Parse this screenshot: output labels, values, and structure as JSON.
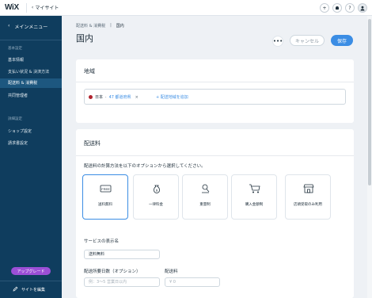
{
  "topbar": {
    "logo": "WiX",
    "mysite": "マイサイト",
    "icons": [
      "add-icon",
      "bell-icon",
      "help-icon",
      "avatar"
    ]
  },
  "sidebar": {
    "main_menu": "メインメニュー",
    "sections": [
      {
        "title": "基本設定",
        "items": [
          "基本情報",
          "支払い状況 & 決済方法",
          "配送料 & 消費税",
          "共同管理者"
        ]
      },
      {
        "title": "詳細設定",
        "items": [
          "ショップ設定",
          "請求書設定"
        ]
      }
    ],
    "active_item": "配送料 & 消費税",
    "upgrade_label": "アップグレード",
    "edit_site_label": "サイトを編集"
  },
  "header": {
    "breadcrumb": [
      "配送料 & 消費税",
      "国内"
    ],
    "title": "国内",
    "more_label": "•••",
    "cancel_label": "キャンセル",
    "save_label": "保存"
  },
  "region_card": {
    "title": "地域",
    "tag_country": "日本",
    "tag_sub": "47 都道府県",
    "tag_remove": "×",
    "add_label": "+ 配送地域を追加"
  },
  "shipping_card": {
    "title": "配送料",
    "description": "配送料の計算方法を以下のオプションから選択してください。",
    "options": [
      {
        "label": "送料無料",
        "icon": "free-icon",
        "selected": true
      },
      {
        "label": "一律料金",
        "icon": "money-bag-icon",
        "selected": false
      },
      {
        "label": "重量制",
        "icon": "weight-icon",
        "selected": false
      },
      {
        "label": "購入金額制",
        "icon": "cart-icon",
        "selected": false
      },
      {
        "label": "店頭受取のみ利用",
        "icon": "store-icon",
        "selected": false
      }
    ],
    "service_label": "サービスの表示名",
    "service_value": "送料無料",
    "delivery_label": "配送所要日数（オプション）",
    "delivery_placeholder": "例：3〜5 営業日以内",
    "fee_label": "配送料",
    "fee_placeholder": "¥ 0"
  },
  "colors": {
    "sidebar": "#0f3d5e",
    "sidebar_active": "#1d577f",
    "accent": "#3b8de4",
    "upgrade": "#9b4fd6"
  }
}
